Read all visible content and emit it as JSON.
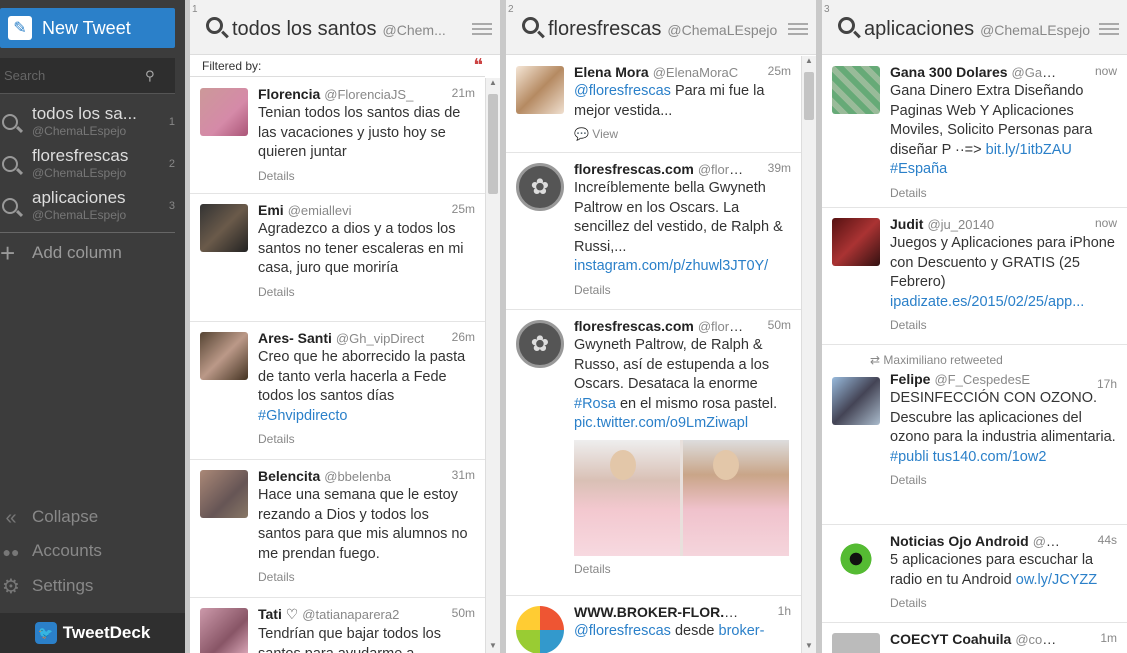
{
  "sidebar": {
    "new_tweet_label": "New Tweet",
    "search_placeholder": "Search",
    "columns": [
      {
        "title": "todos los sa...",
        "user": "@ChemaLEspejo",
        "num": "1"
      },
      {
        "title": "floresfrescas",
        "user": "@ChemaLEspejo",
        "num": "2"
      },
      {
        "title": "aplicaciones",
        "user": "@ChemaLEspejo",
        "num": "3"
      }
    ],
    "add_column_label": "Add column",
    "collapse_label": "Collapse",
    "accounts_label": "Accounts",
    "settings_label": "Settings",
    "brand": "TweetDeck"
  },
  "columns": [
    {
      "index": "1",
      "title": "todos los santos",
      "user": "@Chem...",
      "filtered_label": "Filtered by:",
      "tweets": [
        {
          "name": "Florencia",
          "handle": "@FlorenciaJS_",
          "time": "21m",
          "text": "Tenian todos los santos dias de las vacaciones y justo hoy se quieren juntar",
          "details": "Details"
        },
        {
          "name": "Emi",
          "handle": "@emiallevi",
          "time": "25m",
          "text": "Agradezco a dios y a todos los santos no tener escaleras en mi casa, juro que moriría",
          "details": "Details"
        },
        {
          "name": "Ares- Santi",
          "handle": "@Gh_vipDirect",
          "time": "26m",
          "text": "Creo que he aborrecido la pasta de tanto verla hacerla a Fede todos los santos días",
          "link": "#Ghvipdirecto",
          "details": "Details"
        },
        {
          "name": "Belencita",
          "handle": "@bbelenba",
          "time": "31m",
          "text": "Hace una semana que le estoy rezando a Dios y todos los santos para que mis alumnos no me prendan fuego.",
          "details": "Details"
        },
        {
          "name": "Tati ♡",
          "handle": "@tatianaparera2",
          "time": "50m",
          "text": "Tendrían que bajar todos los santos para ayudarme a",
          "details": ""
        }
      ]
    },
    {
      "index": "2",
      "title": "floresfrescas",
      "user": "@ChemaLEspejo",
      "tweets": [
        {
          "name": "Elena Mora",
          "handle": "@ElenaMoraC",
          "time": "25m",
          "mention": "@floresfrescas",
          "text": " Para mi fue la mejor vestida...",
          "view": "View"
        },
        {
          "name": "floresfrescas.com",
          "handle": "@flore...",
          "time": "39m",
          "text": "Increíblemente bella Gwyneth Paltrow en los Oscars. La sencillez del vestido, de Ralph & Russi,... ",
          "link": "instagram.com/p/zhuwl3JT0Y/",
          "details": "Details"
        },
        {
          "name": "floresfrescas.com",
          "handle": "@flore...",
          "time": "50m",
          "text": "Gwyneth Paltrow, de Ralph & Russo, así de estupenda a los Oscars. Desataca la enorme ",
          "link": "#Rosa",
          "text2": " en el mismo rosa pastel. ",
          "link2": "pic.twitter.com/o9LmZiwapl",
          "details": "Details"
        },
        {
          "name": "WWW.BROKER-FLOR.ES...",
          "handle": "",
          "time": "1h",
          "mention": "@floresfrescas",
          "text": " desde ",
          "link": "broker-"
        }
      ]
    },
    {
      "index": "3",
      "title": "aplicaciones",
      "user": "@ChemaLEspejo",
      "tweets": [
        {
          "name": "Gana 300 Dolares",
          "handle": "@Gana...",
          "time": "now",
          "text": "Gana Dinero Extra Diseñando Paginas Web Y Aplicaciones Moviles, Solicito Personas para diseñar P ··=> ",
          "link": "bit.ly/1itbZAU",
          "link2": "#España",
          "details": "Details"
        },
        {
          "name": "Judit",
          "handle": "@ju_20140",
          "time": "now",
          "text": "Juegos y Aplicaciones para iPhone con Descuento y GRATIS (25 Febrero) ",
          "link": "ipadizate.es/2015/02/25/app...",
          "details": "Details"
        },
        {
          "retweet": "Maximiliano retweeted",
          "name": "Felipe",
          "handle": "@F_CespedesE",
          "time": "17h",
          "text": "DESINFECCIÓN CON OZONO. Descubre las aplicaciones del ozono para la industria alimentaria. ",
          "link": "#publi",
          "link2": "tus140.com/1ow2",
          "details": "Details"
        },
        {
          "name": "Noticias Ojo Android",
          "handle": "@O...",
          "time": "44s",
          "text": "5 aplicaciones para escuchar la radio en tu Android ",
          "link": "ow.ly/JCYZZ",
          "details": "Details"
        },
        {
          "name": "COECYT Coahuila",
          "handle": "@coe...",
          "time": "1m",
          "text": "",
          "details": ""
        }
      ]
    }
  ],
  "colors": {
    "accent": "#2b80c9",
    "sidebar": "#3c3c3c"
  }
}
